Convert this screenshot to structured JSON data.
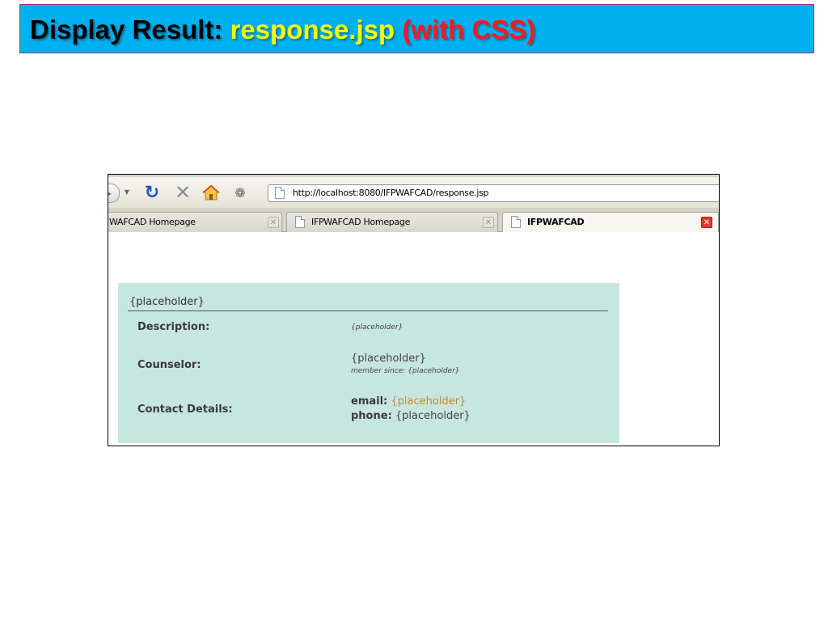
{
  "slide": {
    "title_part1": "Display Result:",
    "title_part2": "response.jsp",
    "title_part3": "(with CSS)",
    "colors": {
      "banner": "#00b0f0",
      "part1": "#000000",
      "part2": "#ffff00",
      "part3": "#ff1a1a"
    }
  },
  "browser": {
    "url": "http://localhost:8080/IFPWAFCAD/response.jsp",
    "toolbar_icons": [
      "forward-icon",
      "dropdown-icon",
      "reload-icon",
      "stop-icon",
      "home-icon",
      "addon-icon"
    ],
    "tabs": [
      {
        "label": "WAFCAD Homepage",
        "active": false
      },
      {
        "label": "IFPWAFCAD Homepage",
        "active": false
      },
      {
        "label": "IFPWAFCAD",
        "active": true
      }
    ]
  },
  "page": {
    "heading": "{placeholder}",
    "description": {
      "label": "Description:",
      "value": "{placeholder}"
    },
    "counselor": {
      "label": "Counselor:",
      "name": "{placeholder}",
      "member_since_label": "member since:",
      "member_since_value": "{placeholder}"
    },
    "contact": {
      "label": "Contact Details:",
      "email_label": "email:",
      "email_value": "{placeholder}",
      "phone_label": "phone:",
      "phone_value": "{placeholder}"
    },
    "colors": {
      "panel": "#c7e6df",
      "link": "#c88a2e"
    }
  }
}
